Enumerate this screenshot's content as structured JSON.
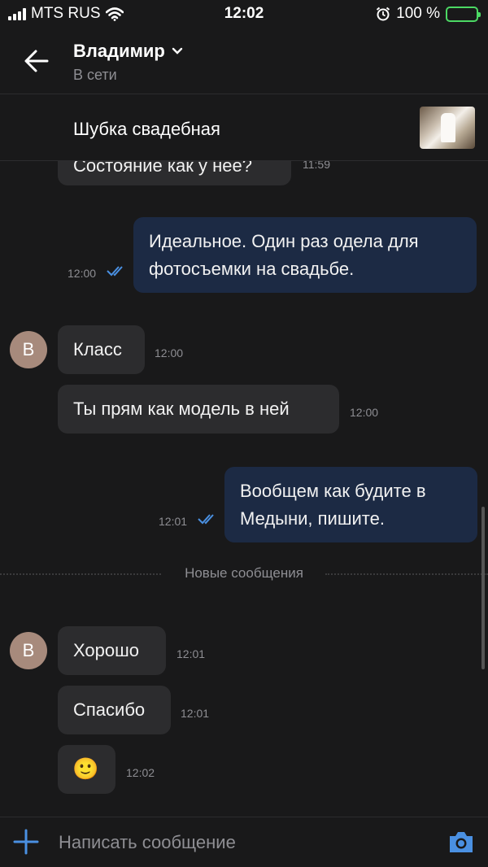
{
  "status_bar": {
    "carrier": "MTS RUS",
    "time": "12:02",
    "battery": "100 %"
  },
  "header": {
    "name": "Владимир",
    "status": "В сети"
  },
  "pinned": {
    "title": "Шубка свадебная"
  },
  "messages": [
    {
      "text": "Состояние как у нее?",
      "time": "11:59"
    },
    {
      "text_line1": "Идеальное. Один раз одела для",
      "text_line2": "фотосъемки на свадьбе.",
      "time": "12:00"
    },
    {
      "avatar": "В",
      "text": "Класс",
      "time": "12:00"
    },
    {
      "text": "Ты прям как модель в ней",
      "time": "12:00"
    },
    {
      "text_line1": "Вообщем как будите в",
      "text_line2": "Медыни, пишите.",
      "time": "12:01"
    },
    {
      "avatar": "В",
      "text": "Хорошо",
      "time": "12:01"
    },
    {
      "text": "Спасибо",
      "time": "12:01"
    },
    {
      "text": "🙂",
      "time": "12:02"
    }
  ],
  "divider": {
    "label": "Новые сообщения"
  },
  "composer": {
    "placeholder": "Написать сообщение"
  },
  "colors": {
    "accent": "#4a90e2",
    "incoming": "#2c2c2e",
    "outgoing": "#1c2a44",
    "avatar": "#a78a7c"
  },
  "icons": [
    "signal-icon",
    "wifi-icon",
    "alarm-icon",
    "battery-icon",
    "back-arrow-icon",
    "chevron-down-icon",
    "double-check-icon",
    "plus-icon",
    "camera-icon"
  ]
}
